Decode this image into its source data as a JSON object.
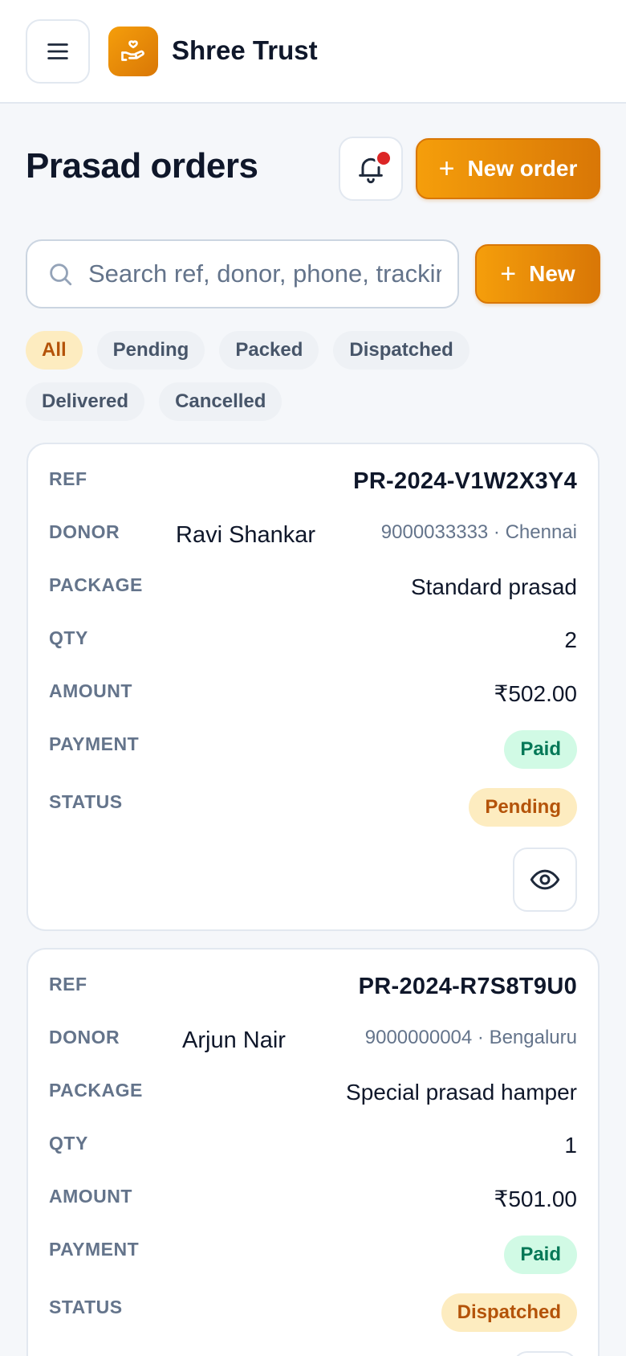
{
  "app": {
    "name": "Shree Trust",
    "brand_color": "#f59e0b"
  },
  "header": {
    "menu_icon": "hamburger-menu-icon",
    "logo_icon": "hand-heart-icon"
  },
  "page": {
    "title": "Prasad orders",
    "notification_icon": "bell-icon",
    "new_order_label": "New order"
  },
  "search": {
    "placeholder": "Search ref, donor, phone, tracking",
    "value": "",
    "new_label": "New"
  },
  "filters": [
    {
      "label": "All",
      "active": true
    },
    {
      "label": "Pending",
      "active": false
    },
    {
      "label": "Packed",
      "active": false
    },
    {
      "label": "Dispatched",
      "active": false
    },
    {
      "label": "Delivered",
      "active": false
    },
    {
      "label": "Cancelled",
      "active": false
    }
  ],
  "labels": {
    "ref": "REF",
    "donor": "DONOR",
    "package": "PACKAGE",
    "qty": "QTY",
    "amount": "AMOUNT",
    "payment": "PAYMENT",
    "status": "STATUS"
  },
  "orders": [
    {
      "ref": "PR-2024-V1W2X3Y4",
      "donor_name": "Ravi Shankar",
      "donor_meta": "9000033333 · Chennai",
      "package": "Standard prasad",
      "qty": "2",
      "amount": "₹502.00",
      "payment": "Paid",
      "status": "Pending"
    },
    {
      "ref": "PR-2024-R7S8T9U0",
      "donor_name": "Arjun Nair",
      "donor_meta": "9000000004 · Bengaluru",
      "package": "Special prasad hamper",
      "qty": "1",
      "amount": "₹501.00",
      "payment": "Paid",
      "status": "Dispatched"
    }
  ]
}
